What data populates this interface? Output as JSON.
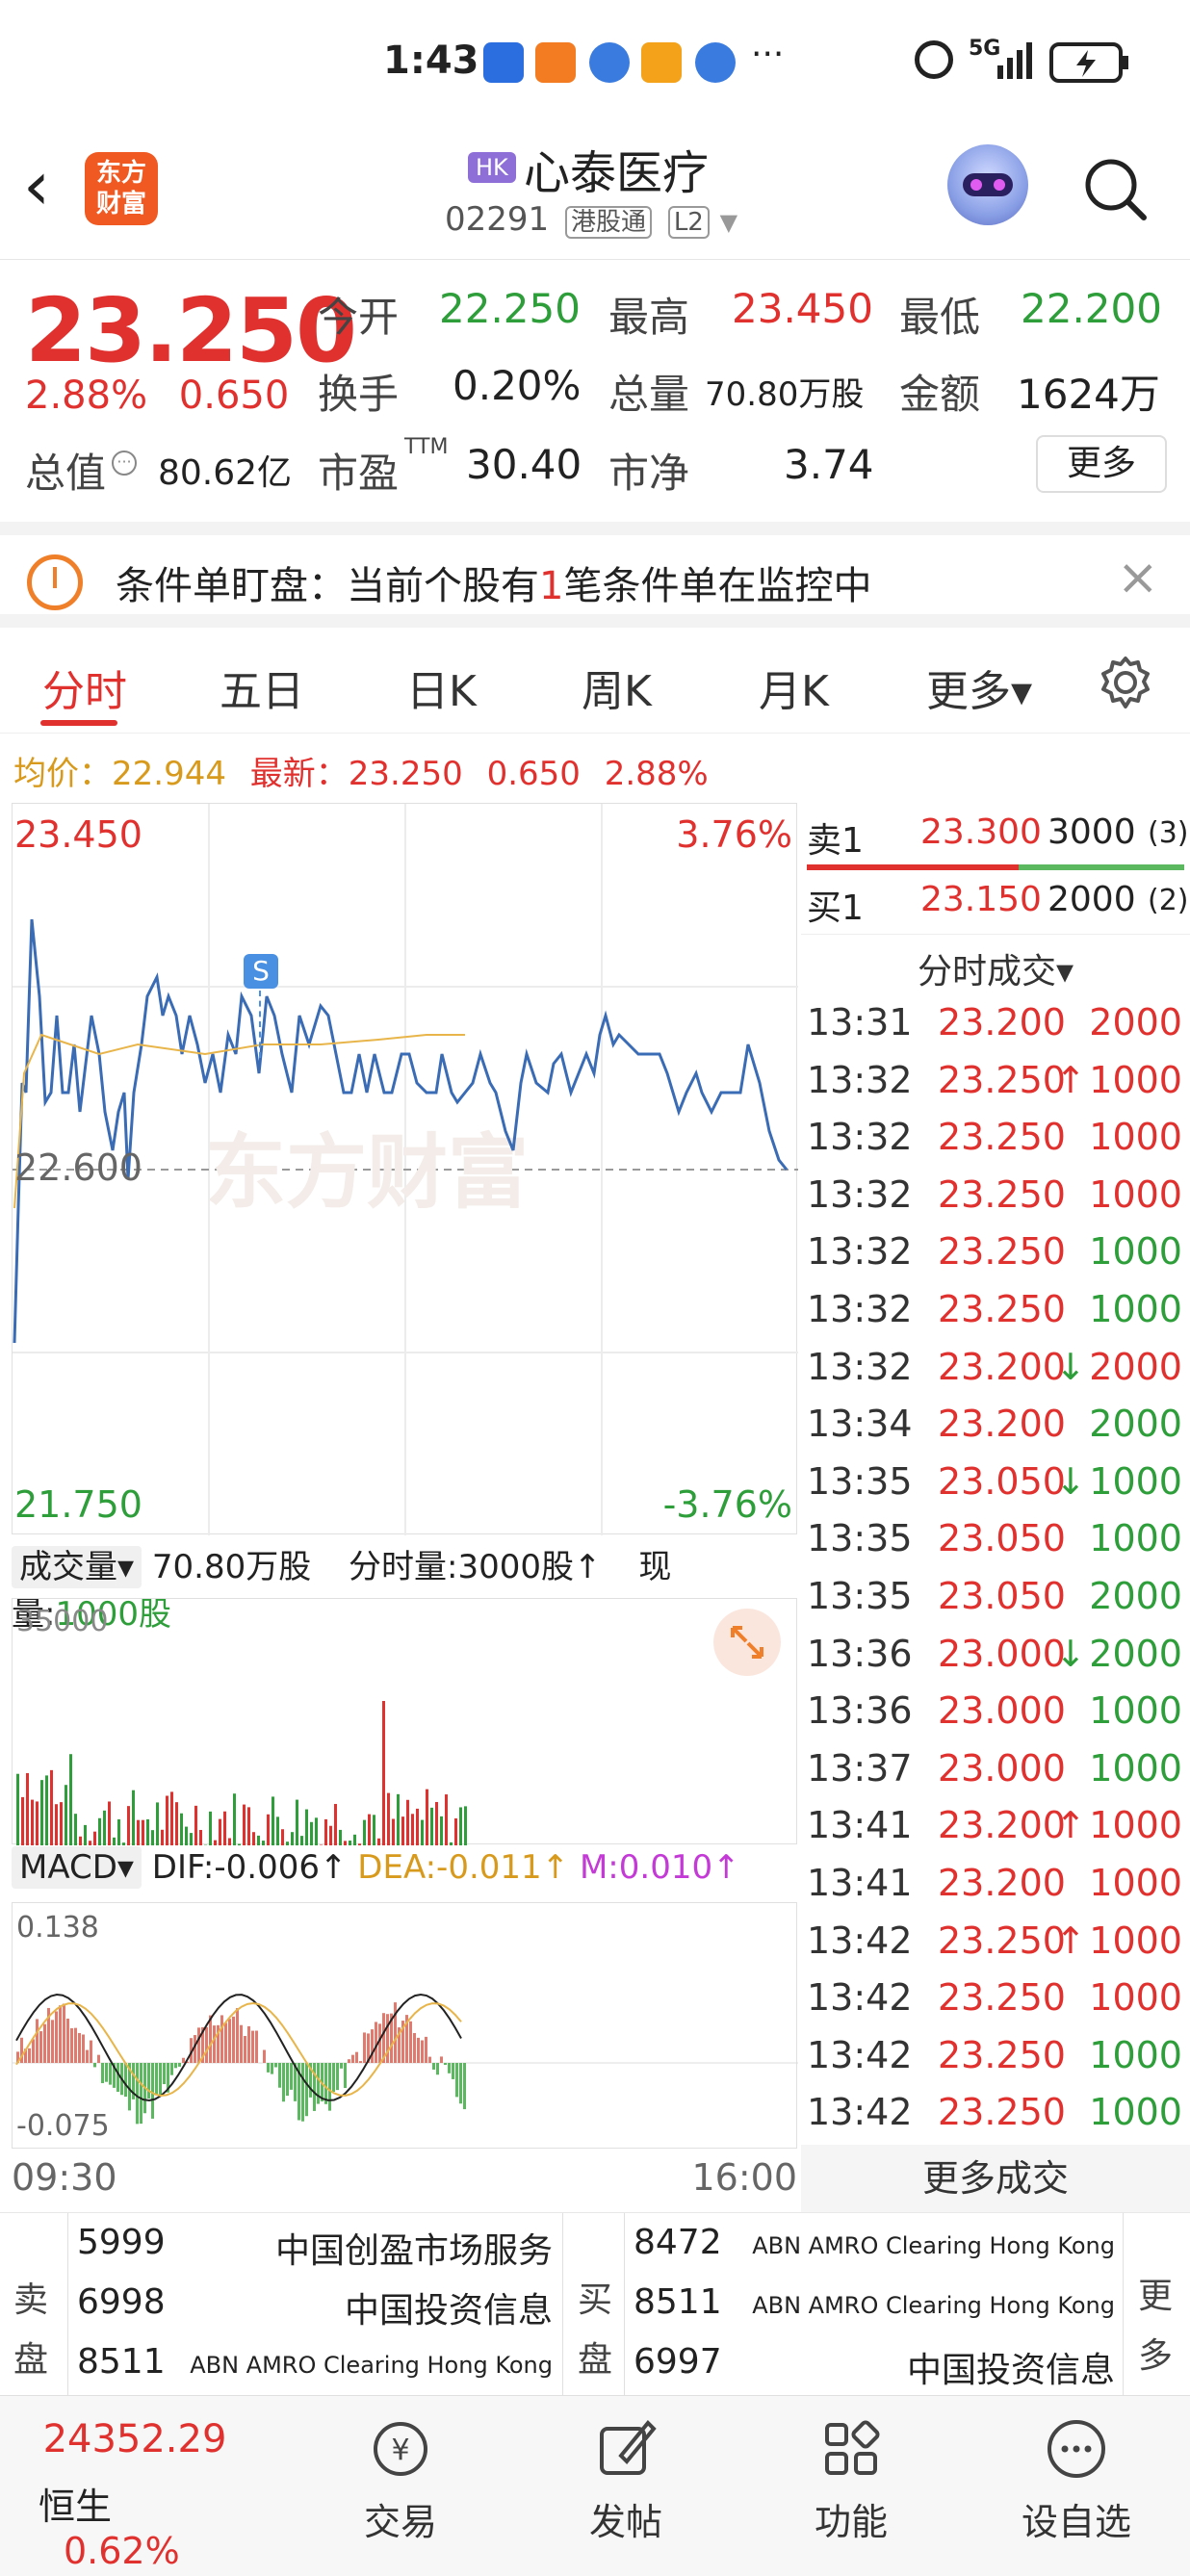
{
  "status": {
    "time": "1:43",
    "network": "5G",
    "more": "···"
  },
  "header": {
    "back": "‹",
    "logo_line1": "东方",
    "logo_line2": "财富",
    "market_tag": "HK",
    "name": "心泰医疗",
    "code": "02291",
    "connect": "港股通",
    "level": "L2"
  },
  "quote": {
    "price": "23.250",
    "change_pct": "2.88%",
    "change": "0.650",
    "open_label": "今开",
    "open": "22.250",
    "high_label": "最高",
    "high": "23.450",
    "low_label": "最低",
    "low": "22.200",
    "turnover_label": "换手",
    "turnover": "0.20%",
    "volume_label": "总量",
    "volume": "70.80万股",
    "amount_label": "金额",
    "amount": "1624万",
    "mcap_label": "总值",
    "mcap": "80.62亿",
    "pe_label": "市盈",
    "pe_sup": "TTM",
    "pe": "30.40",
    "pb_label": "市净",
    "pb": "3.74",
    "more": "更多"
  },
  "condition": {
    "prefix": "条件单盯盘：当前个股有",
    "count": "1",
    "suffix": "笔条件单在监控中",
    "close": "×"
  },
  "tabs": {
    "t1": "分时",
    "t2": "五日",
    "t3": "日K",
    "t4": "周K",
    "t5": "月K",
    "t6": "更多▾"
  },
  "avg": {
    "avg_label": "均价：",
    "avg": "22.944",
    "last_label": "最新：",
    "last": "23.250",
    "chg": "0.650",
    "pct": "2.88%"
  },
  "chart": {
    "top_price": "23.450",
    "top_pct": "3.76%",
    "mid_price": "22.600",
    "bot_price": "21.750",
    "bot_pct": "-3.76%",
    "watermark": "东方财富",
    "s_marker": "S"
  },
  "volume": {
    "label": "成交量▾",
    "total": "70.80万股",
    "tick_label": "分时量:3000股↑",
    "now_label": "现量:",
    "now": "1000股",
    "max": "35000"
  },
  "macd": {
    "label": "MACD▾",
    "dif": "DIF:-0.006↑",
    "dea": "DEA:-0.011↑",
    "m": "M:0.010↑",
    "top": "0.138",
    "bot": "-0.075"
  },
  "time_axis": {
    "start": "09:30",
    "end": "16:00"
  },
  "orderbook": {
    "ask_label": "卖1",
    "ask": "23.300",
    "ask_vol": "3000",
    "ask_cnt": "(3)",
    "bid_label": "买1",
    "bid": "23.150",
    "bid_vol": "2000",
    "bid_cnt": "(2)",
    "ticks_title": "分时成交▾",
    "more": "更多成交"
  },
  "trades": [
    {
      "t": "13:31",
      "p": "23.200",
      "a": "",
      "v": "2000",
      "vc": "red"
    },
    {
      "t": "13:32",
      "p": "23.250",
      "a": "↑",
      "v": "1000",
      "vc": "red"
    },
    {
      "t": "13:32",
      "p": "23.250",
      "a": "",
      "v": "1000",
      "vc": "red"
    },
    {
      "t": "13:32",
      "p": "23.250",
      "a": "",
      "v": "1000",
      "vc": "red"
    },
    {
      "t": "13:32",
      "p": "23.250",
      "a": "",
      "v": "1000",
      "vc": "green"
    },
    {
      "t": "13:32",
      "p": "23.250",
      "a": "",
      "v": "1000",
      "vc": "green"
    },
    {
      "t": "13:32",
      "p": "23.200",
      "a": "↓",
      "v": "2000",
      "vc": "red"
    },
    {
      "t": "13:34",
      "p": "23.200",
      "a": "",
      "v": "2000",
      "vc": "green"
    },
    {
      "t": "13:35",
      "p": "23.050",
      "a": "↓",
      "v": "1000",
      "vc": "green"
    },
    {
      "t": "13:35",
      "p": "23.050",
      "a": "",
      "v": "1000",
      "vc": "green"
    },
    {
      "t": "13:35",
      "p": "23.050",
      "a": "",
      "v": "2000",
      "vc": "green"
    },
    {
      "t": "13:36",
      "p": "23.000",
      "a": "↓",
      "v": "2000",
      "vc": "green"
    },
    {
      "t": "13:36",
      "p": "23.000",
      "a": "",
      "v": "1000",
      "vc": "green"
    },
    {
      "t": "13:37",
      "p": "23.000",
      "a": "",
      "v": "1000",
      "vc": "green"
    },
    {
      "t": "13:41",
      "p": "23.200",
      "a": "↑",
      "v": "1000",
      "vc": "red"
    },
    {
      "t": "13:41",
      "p": "23.200",
      "a": "",
      "v": "1000",
      "vc": "red"
    },
    {
      "t": "13:42",
      "p": "23.250",
      "a": "↑",
      "v": "1000",
      "vc": "red"
    },
    {
      "t": "13:42",
      "p": "23.250",
      "a": "",
      "v": "1000",
      "vc": "red"
    },
    {
      "t": "13:42",
      "p": "23.250",
      "a": "",
      "v": "1000",
      "vc": "green"
    },
    {
      "t": "13:42",
      "p": "23.250",
      "a": "",
      "v": "1000",
      "vc": "green"
    }
  ],
  "brokers": {
    "sell_label": "卖盘",
    "buy_label": "买盘",
    "more": "更多",
    "sell": [
      {
        "id": "5999",
        "name": "中国创盈市场服务"
      },
      {
        "id": "6998",
        "name": "中国投资信息"
      },
      {
        "id": "8511",
        "name": "ABN AMRO Clearing Hong Kong"
      }
    ],
    "buy": [
      {
        "id": "8472",
        "name": "ABN AMRO Clearing Hong Kong"
      },
      {
        "id": "8511",
        "name": "ABN AMRO Clearing Hong Kong"
      },
      {
        "id": "6997",
        "name": "中国投资信息"
      }
    ]
  },
  "nav": {
    "index_value": "24352.29",
    "index_name": "恒生",
    "index_pct": "0.62%",
    "trade": "交易",
    "post": "发帖",
    "func": "功能",
    "watch": "设自选"
  },
  "colors": {
    "up": "#e0312f",
    "down": "#2e9e3a",
    "avg": "#e8b54a",
    "line": "#3a6bb5",
    "accent": "#f05a22"
  }
}
